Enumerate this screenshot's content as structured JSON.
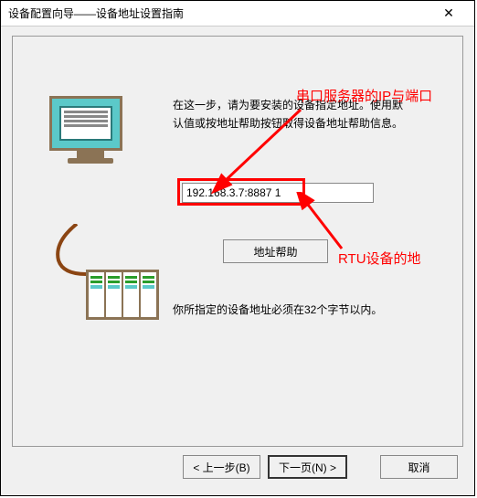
{
  "window": {
    "title": "设备配置向导——设备地址设置指南"
  },
  "instructions": {
    "line1": "在这一步，请为要安装的设备指定地址。使用默",
    "line2": "认值或按地址帮助按钮取得设备地址帮助信息。"
  },
  "input": {
    "value": "192.168.3.7:8887 1"
  },
  "help_button": "地址帮助",
  "hint": "你所指定的设备地址必须在32个字节以内。",
  "callouts": {
    "ip_port": "串口服务器的IP与端口",
    "rtu": "RTU设备的地"
  },
  "buttons": {
    "back": "< 上一步(B)",
    "next": "下一页(N) >",
    "cancel": "取消"
  }
}
